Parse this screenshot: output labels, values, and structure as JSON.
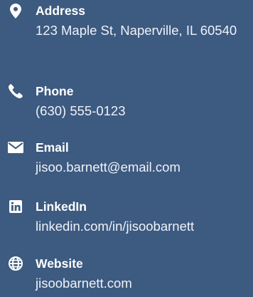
{
  "contacts": [
    {
      "label": "Address",
      "value": "123 Maple St, Naperville, IL 60540",
      "icon": "map-pin-icon"
    },
    {
      "label": "Phone",
      "value": "(630) 555-0123",
      "icon": "phone-icon"
    },
    {
      "label": "Email",
      "value": "jisoo.barnett@email.com",
      "icon": "envelope-icon"
    },
    {
      "label": "LinkedIn",
      "value": "linkedin.com/in/jisoobarnett",
      "icon": "linkedin-icon"
    },
    {
      "label": "Website",
      "value": "jisoobarnett.com",
      "icon": "globe-icon"
    }
  ],
  "colors": {
    "background": "#3d5a80",
    "text": "#ffffff"
  }
}
